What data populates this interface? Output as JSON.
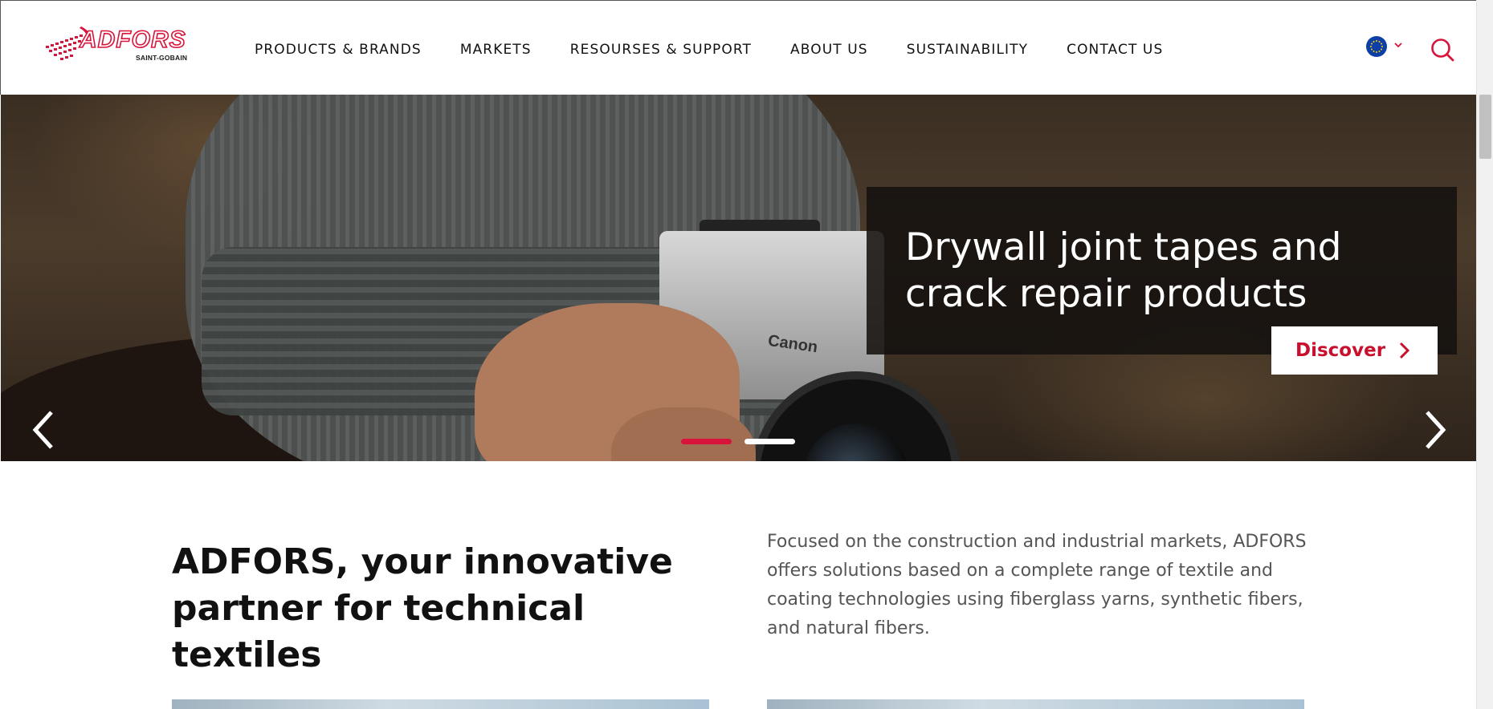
{
  "brand": {
    "logo_text": "ADFORS",
    "logo_subtext": "SAINT-GOBAIN",
    "accent_color": "#d9143c"
  },
  "nav": {
    "items": [
      {
        "label": "PRODUCTS & BRANDS"
      },
      {
        "label": "MARKETS"
      },
      {
        "label": "RESOURSES & SUPPORT"
      },
      {
        "label": "ABOUT US"
      },
      {
        "label": "SUSTAINABILITY"
      },
      {
        "label": "CONTACT US"
      }
    ],
    "language_icon": "eu-flag-icon",
    "search_icon": "search-icon"
  },
  "hero": {
    "title": "Drywall joint tapes and crack repair products",
    "camera_brand": "Canon",
    "cta_label": "Discover",
    "slides": [
      {
        "active": true,
        "color": "#d9143c"
      },
      {
        "active": false,
        "color": "#ffffff"
      }
    ],
    "prev_icon": "chevron-left-icon",
    "next_icon": "chevron-right-icon"
  },
  "intro": {
    "title": "ADFORS, your innovative partner for technical textiles",
    "text": "Focused on the construction and industrial markets, ADFORS offers solutions based on a complete range of textile and coating technologies using fiberglass yarns, synthetic fibers, and natural fibers."
  }
}
